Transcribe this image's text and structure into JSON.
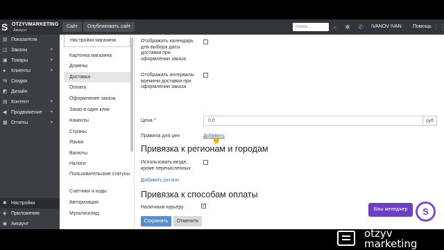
{
  "brand": {
    "name": "OTZYVMARKETING",
    "sub": "Аккаунт",
    "logo": "S"
  },
  "topbar": {
    "site_btn": "Сайт",
    "publish_btn": "Опубликовать сайт",
    "search_placeholder": "поиск...",
    "user": "IVANOV IVAN",
    "help": "Помощь",
    "icons": [
      "gear-icon",
      "phone-icon",
      "grid-icon"
    ]
  },
  "nav": {
    "items": [
      {
        "label": "Показатели",
        "icon": "chart-icon",
        "chevron": false
      },
      {
        "label": "Заказы",
        "icon": "cart-icon",
        "chevron": true
      },
      {
        "label": "Товары",
        "icon": "box-icon",
        "chevron": true
      },
      {
        "label": "Клиенты",
        "icon": "users-icon",
        "chevron": true
      },
      {
        "label": "Скидки",
        "icon": "percent-icon",
        "chevron": false
      },
      {
        "label": "Дизайн",
        "icon": "brush-icon",
        "chevron": false
      },
      {
        "label": "Контент",
        "icon": "doc-icon",
        "chevron": true
      },
      {
        "label": "Продвижение",
        "icon": "megaphone-icon",
        "chevron": true
      },
      {
        "label": "Отчеты",
        "icon": "report-icon",
        "chevron": true
      }
    ],
    "bottom": [
      {
        "label": "Настройки",
        "icon": "gear-icon"
      },
      {
        "label": "Приложения",
        "icon": "apps-icon"
      },
      {
        "label": "Аккаунт",
        "icon": "account-icon"
      }
    ]
  },
  "submenu": {
    "header": "Настройки магазина",
    "items": [
      "Карточка магазина",
      "Домены",
      "Доставка",
      "Оплата",
      "Оформление заказа",
      "Заказ в один клик",
      "Клиенты",
      "Страны",
      "Языки",
      "Валюты",
      "Налоги",
      "Пользовательские статусы",
      "Счетчики и коды",
      "Авторизация",
      "Мультисклад"
    ],
    "selected": "Доставка"
  },
  "form": {
    "calendar_label": "Отображать календарь для выбора даты доставки при оформлении заказа",
    "intervals_label": "Отображать интервалы времени доставки при оформлении заказа",
    "price_label": "Цена *",
    "price_value": "0.0",
    "price_unit": "руб",
    "rules_label": "Правила для цен",
    "rules_link": "Добавить",
    "regions_heading": "Привязка к регионам и городам",
    "everywhere_label": "Использовать везде, кроме перечисленных",
    "add_region_link": "Добавить регион",
    "payment_heading": "Привязка к способам оплаты",
    "cash_label": "Наличным курьеру",
    "cash_checked": true,
    "save_btn": "Сохранить",
    "cancel_btn": "Отменить"
  },
  "widget": {
    "manager_btn": "Ваш менеджер",
    "logo": "S"
  },
  "footer": {
    "brand_line1": "otzyv",
    "brand_line2": "marketing"
  }
}
